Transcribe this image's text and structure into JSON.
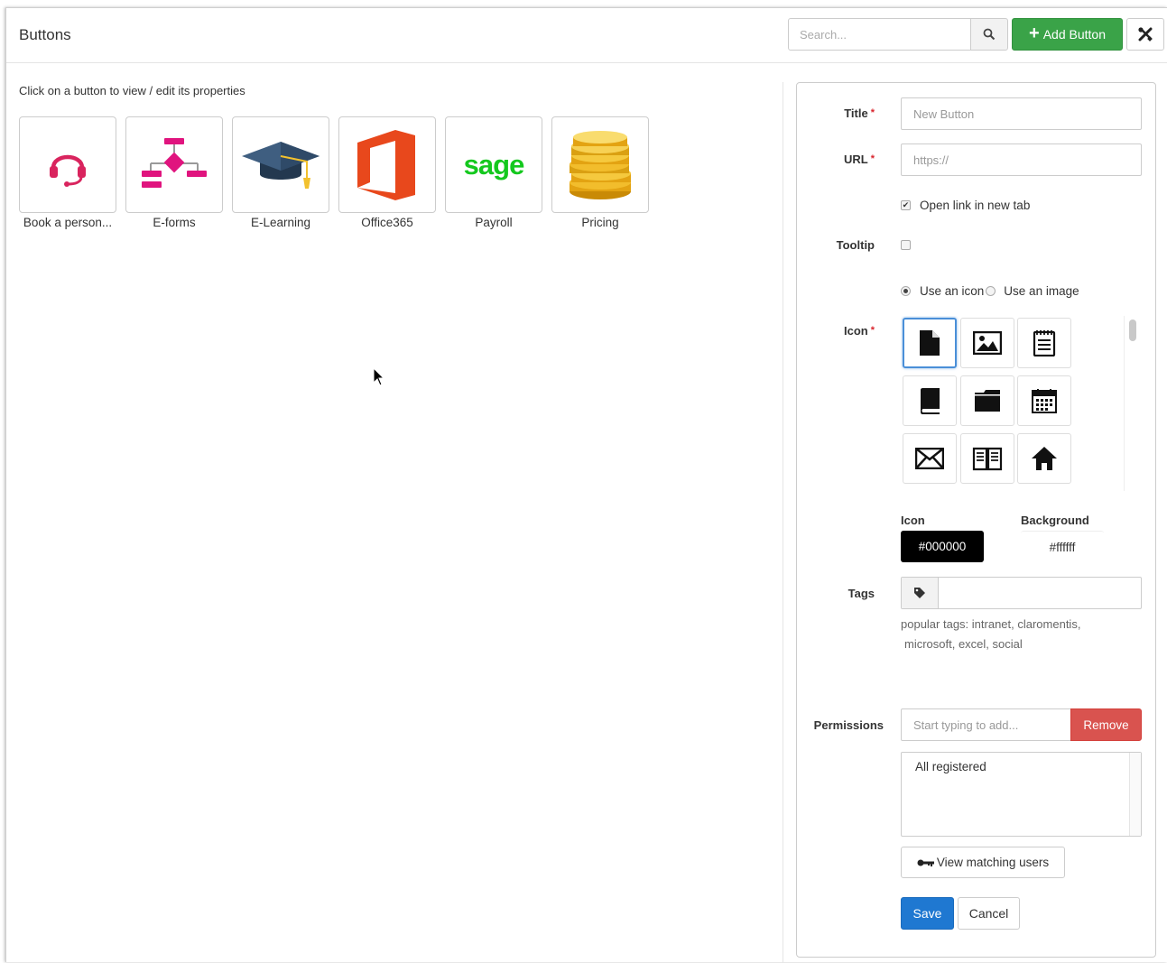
{
  "header": {
    "title": "Buttons",
    "search_placeholder": "Search...",
    "add_label": "Add Button"
  },
  "left": {
    "instructions": "Click on a button to view / edit its properties",
    "tiles": [
      {
        "label": "Book a person...",
        "icon": "headset-icon"
      },
      {
        "label": "E-forms",
        "icon": "flowchart-icon"
      },
      {
        "label": "E-Learning",
        "icon": "graduation-cap-icon"
      },
      {
        "label": "Office365",
        "icon": "office365-logo"
      },
      {
        "label": "Payroll",
        "icon": "sage-logo",
        "logo_text": "sage"
      },
      {
        "label": "Pricing",
        "icon": "coins-stack-icon"
      }
    ]
  },
  "form": {
    "title_label": "Title",
    "title_placeholder": "New Button",
    "url_label": "URL",
    "url_placeholder": "https://",
    "open_new_tab_label": "Open link in new tab",
    "open_new_tab_checked": true,
    "tooltip_label": "Tooltip",
    "tooltip_checked": false,
    "use_icon_label": "Use an icon",
    "use_image_label": "Use an image",
    "icon_label": "Icon",
    "icon_options": [
      "file-icon",
      "image-icon",
      "notepad-icon",
      "book-icon",
      "folder-icon",
      "calendar-icon",
      "envelope-icon",
      "open-book-icon",
      "home-icon"
    ],
    "icon_color_label": "Icon",
    "icon_color": "#000000",
    "background_color_label": "Background",
    "background_color": "#ffffff",
    "tags_label": "Tags",
    "popular_tags_line1": "popular tags:  intranet,  claromentis,",
    "popular_tags_line2": "microsoft,  excel,  social",
    "permissions_label": "Permissions",
    "permissions_placeholder": "Start typing to add...",
    "remove_label": "Remove",
    "permission_item": "All registered",
    "view_users_label": "View matching users",
    "save_label": "Save",
    "cancel_label": "Cancel"
  },
  "colors": {
    "add_button": "#3aa348",
    "remove_button": "#d9534f",
    "save_button": "#1f78d1",
    "required": "#d9242c"
  }
}
